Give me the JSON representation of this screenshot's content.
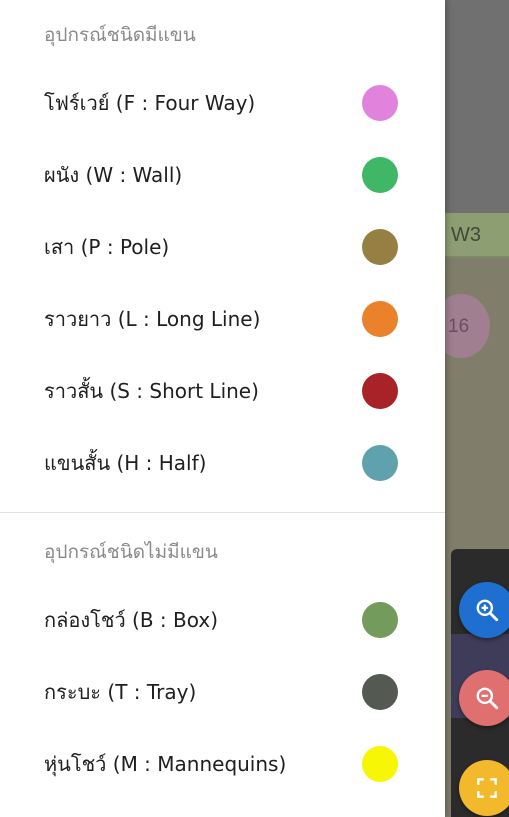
{
  "background": {
    "strip_label": "W3",
    "circle_label": "16"
  },
  "drawer": {
    "section_with_arm": {
      "title": "อุปกรณ์ชนิดมีแขน",
      "items": [
        {
          "label": "โฟร์เวย์ (F : Four Way)",
          "color": "#e183dc"
        },
        {
          "label": "ผนัง (W : Wall)",
          "color": "#40b766"
        },
        {
          "label": "เสา (P : Pole)",
          "color": "#957f42"
        },
        {
          "label": "ราวยาว (L : Long Line)",
          "color": "#e9822a"
        },
        {
          "label": "ราวสั้น (S : Short Line)",
          "color": "#a82328"
        },
        {
          "label": "แขนสั้น (H : Half)",
          "color": "#5fa2ad"
        }
      ]
    },
    "section_without_arm": {
      "title": "อุปกรณ์ชนิดไม่มีแขน",
      "items": [
        {
          "label": "กล่องโชว์ (B : Box)",
          "color": "#739c5c"
        },
        {
          "label": "กระบะ (T : Tray)",
          "color": "#545a52"
        },
        {
          "label": "หุ่นโชว์ (M : Mannequins)",
          "color": "#f7f705"
        }
      ]
    }
  },
  "icons": {
    "zoom_in": "zoom-in-icon",
    "zoom_out": "zoom-out-icon",
    "fullscreen": "fullscreen-icon"
  }
}
